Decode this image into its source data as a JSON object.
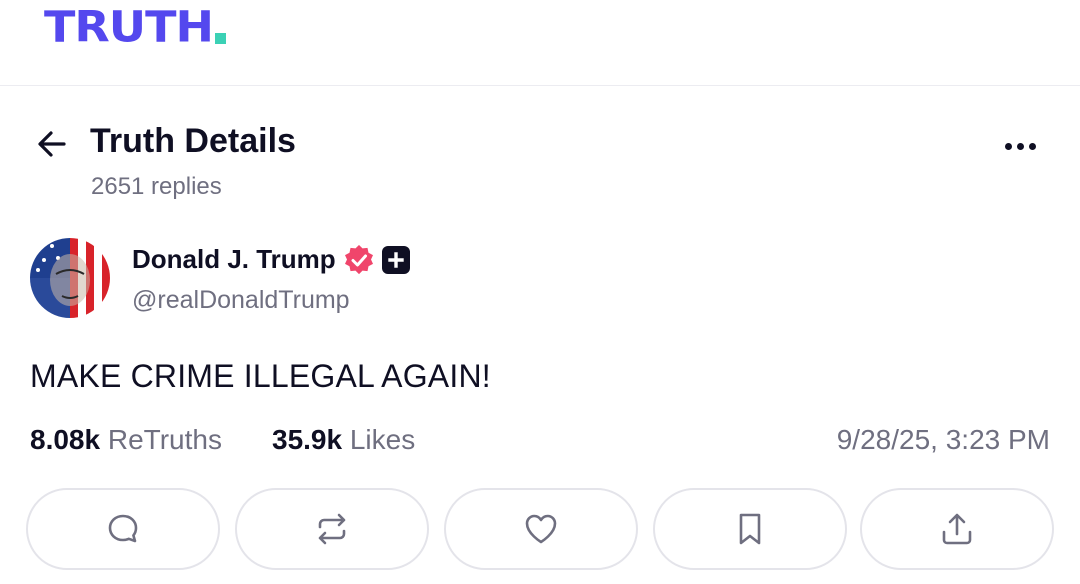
{
  "brand": {
    "logo_text": "TRUTH",
    "logo_color": "#5448ee",
    "logo_dot_color": "#3bd1b5"
  },
  "header": {
    "title": "Truth Details",
    "reply_count": "2651 replies",
    "back_icon": "arrow-left-icon",
    "more_icon": "more-horizontal-icon"
  },
  "post": {
    "author": {
      "name": "Donald J. Trump",
      "handle": "@realDonaldTrump",
      "verified_badge_color": "#f0456b",
      "plus_badge_icon": "plus-square-icon"
    },
    "text": "MAKE CRIME ILLEGAL AGAIN!",
    "retruths": {
      "count": "8.08k",
      "label": "ReTruths"
    },
    "likes": {
      "count": "35.9k",
      "label": "Likes"
    },
    "timestamp": "9/28/25, 3:23 PM"
  },
  "actions": [
    {
      "name": "reply",
      "icon": "comment-icon"
    },
    {
      "name": "retruth",
      "icon": "repost-icon"
    },
    {
      "name": "like",
      "icon": "heart-icon"
    },
    {
      "name": "bookmark",
      "icon": "bookmark-icon"
    },
    {
      "name": "share",
      "icon": "share-upload-icon"
    }
  ]
}
